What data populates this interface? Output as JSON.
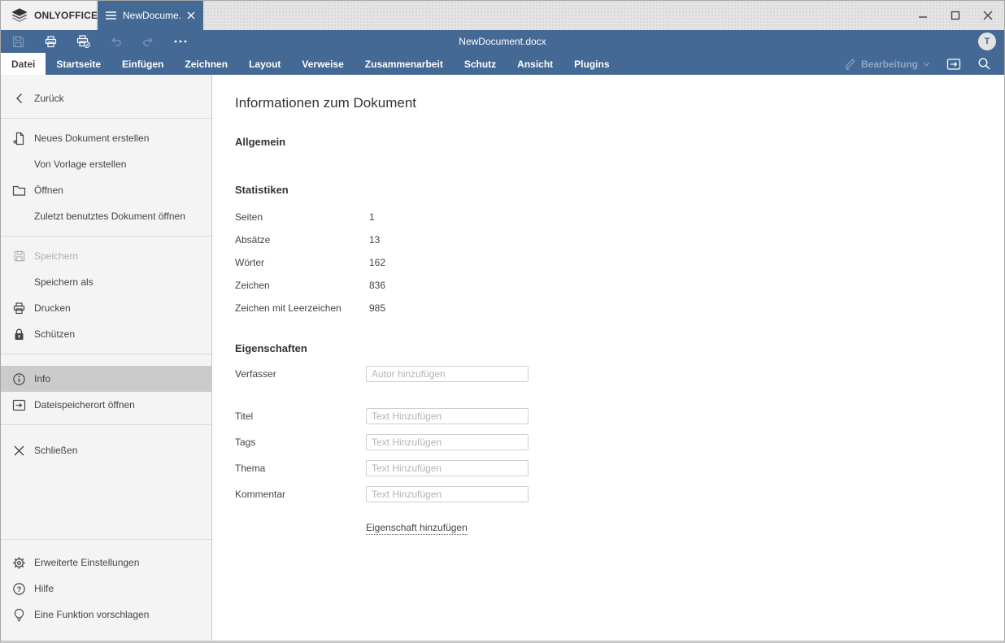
{
  "colors": {
    "accent_blue": "#446995",
    "titlebar_gray": "#e4e4e4",
    "sidebar_bg": "#f4f4f4",
    "selected_item": "#cbcbcb",
    "text": "#444444",
    "disabled_text": "#b0b0b0"
  },
  "titlebar": {
    "brand": "ONLYOFFICE",
    "tab_title": "NewDocume..."
  },
  "toolbar": {
    "document_title": "NewDocument.docx",
    "avatar_initial": "T"
  },
  "tabs": [
    {
      "label": "Datei",
      "active": true
    },
    {
      "label": "Startseite",
      "active": false
    },
    {
      "label": "Einfügen",
      "active": false
    },
    {
      "label": "Zeichnen",
      "active": false
    },
    {
      "label": "Layout",
      "active": false
    },
    {
      "label": "Verweise",
      "active": false
    },
    {
      "label": "Zusammenarbeit",
      "active": false
    },
    {
      "label": "Schutz",
      "active": false
    },
    {
      "label": "Ansicht",
      "active": false
    },
    {
      "label": "Plugins",
      "active": false
    }
  ],
  "tabbar_right": {
    "mode_label": "Bearbeitung"
  },
  "sidebar": {
    "back": "Zurück",
    "new_document": "Neues Dokument erstellen",
    "from_template": "Von Vorlage erstellen",
    "open": "Öffnen",
    "open_recent": "Zuletzt benutztes Dokument öffnen",
    "save": "Speichern",
    "save_as": "Speichern als",
    "print": "Drucken",
    "protect": "Schützen",
    "info": "Info",
    "open_file_location": "Dateispeicherort öffnen",
    "close_menu": "Schließen",
    "advanced_settings": "Erweiterte Einstellungen",
    "help": "Hilfe",
    "suggest_feature": "Eine Funktion vorschlagen"
  },
  "main": {
    "title": "Informationen zum Dokument",
    "section_general": "Allgemein",
    "section_statistics": "Statistiken",
    "section_properties": "Eigenschaften",
    "statistics": [
      {
        "label": "Seiten",
        "value": "1"
      },
      {
        "label": "Absätze",
        "value": "13"
      },
      {
        "label": "Wörter",
        "value": "162"
      },
      {
        "label": "Zeichen",
        "value": "836"
      },
      {
        "label": "Zeichen mit Leerzeichen",
        "value": "985"
      }
    ],
    "properties": [
      {
        "label": "Verfasser",
        "placeholder": "Autor hinzufügen"
      },
      {
        "label": "Titel",
        "placeholder": "Text Hinzufügen"
      },
      {
        "label": "Tags",
        "placeholder": "Text Hinzufügen"
      },
      {
        "label": "Thema",
        "placeholder": "Text Hinzufügen"
      },
      {
        "label": "Kommentar",
        "placeholder": "Text Hinzufügen"
      }
    ],
    "add_property_label": "Eigenschaft hinzufügen"
  }
}
